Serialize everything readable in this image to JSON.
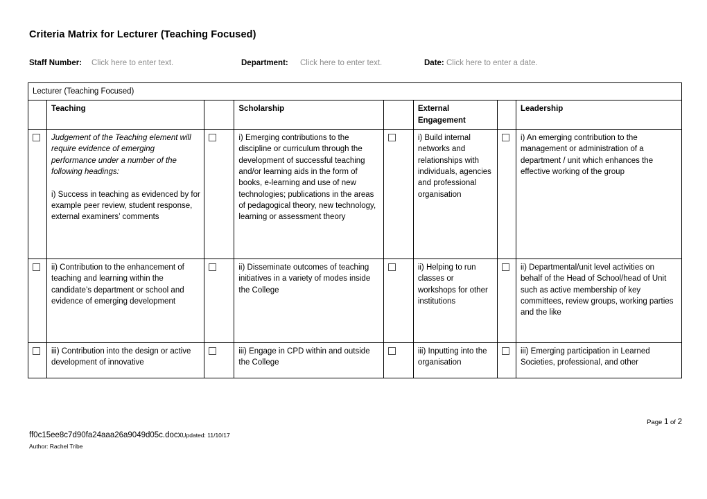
{
  "document": {
    "title": "Criteria Matrix for Lecturer (Teaching Focused)"
  },
  "meta": {
    "staff_label": "Staff Number:",
    "staff_placeholder": "Click here to enter text.",
    "department_label": "Department:",
    "department_placeholder": "Click here to enter text.",
    "date_label": "Date:",
    "date_placeholder": "Click here to enter a date."
  },
  "table": {
    "band_title": "Lecturer (Teaching Focused)",
    "headers": {
      "teaching": "Teaching",
      "scholarship": "Scholarship",
      "external_engagement": "External Engagement",
      "leadership": "Leadership"
    },
    "teaching_note": "Judgement of the Teaching element will require evidence of emerging performance under a number of the following headings:",
    "rows": [
      {
        "teaching": "i) Success in teaching as evidenced by for example peer review, student response, external examiners’ comments",
        "scholarship": "i) Emerging contributions to the discipline or curriculum through the development of successful teaching and/or learning aids in the form of books, e-learning and use of new technologies; publications in the areas of pedagogical theory, new technology, learning or assessment theory",
        "external_engagement": "i) Build internal networks and relationships with individuals, agencies and professional organisation",
        "leadership": "i) An emerging contribution to the management or administration of a department / unit which enhances the effective working of the group"
      },
      {
        "teaching": "ii) Contribution to the enhancement of teaching and learning within the candidate’s department or school and evidence of emerging development",
        "scholarship": "ii) Disseminate outcomes of teaching initiatives in a variety of modes inside the College",
        "external_engagement": "ii) Helping to run classes or workshops for other institutions",
        "leadership": "ii) Departmental/unit level activities on behalf of the Head of School/head of Unit such as active membership of key committees, review groups, working parties and the like"
      },
      {
        "teaching": "iii) Contribution into the design or active development of innovative",
        "scholarship": "iii) Engage in CPD within and outside the College",
        "external_engagement": "iii) Inputting into the organisation",
        "leadership": "iii) Emerging participation in Learned Societies, professional, and other"
      }
    ]
  },
  "footer": {
    "page_prefix": "Page",
    "page_current": "1",
    "page_of": "of",
    "page_total": "2",
    "filename": "ff0c15ee8c7d90fa24aaa26a9049d05c.docx",
    "updated": "Updated: 11/10/17",
    "author": "Author: Rachel Tribe"
  }
}
